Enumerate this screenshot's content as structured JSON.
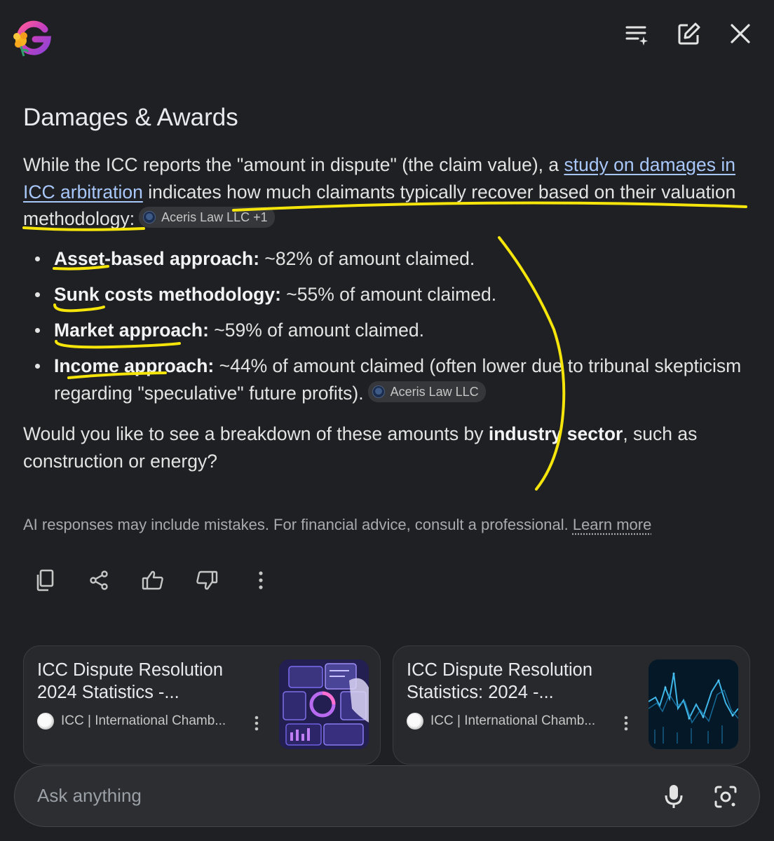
{
  "header": {
    "logo_icon": "google-g-flower-logo",
    "actions": [
      {
        "icon": "list-sparkle-icon"
      },
      {
        "icon": "edit-icon"
      },
      {
        "icon": "close-icon"
      }
    ]
  },
  "content": {
    "title": "Damages & Awards",
    "intro": {
      "before_link": "While the ICC reports the \"amount in dispute\" (the claim value), a ",
      "link_text": "study on damages in ICC arbitration",
      "after_link": " indicates how much claimants typically recover based on their valuation methodology:",
      "citation": "Aceris Law LLC +1"
    },
    "bullets": [
      {
        "label": "Asset-based approach:",
        "text": " ~82% of amount claimed."
      },
      {
        "label": "Sunk costs methodology:",
        "text": " ~55% of amount claimed."
      },
      {
        "label": "Market approach:",
        "text": " ~59% of amount claimed."
      },
      {
        "label": "Income approach:",
        "text": " ~44% of amount claimed (often lower due to tribunal skepticism regarding \"speculative\" future profits).",
        "citation": "Aceris Law LLC"
      }
    ],
    "followup": {
      "before": "Would you like to see a breakdown of these amounts by ",
      "bold": "industry sector",
      "after": ", such as construction or energy?"
    }
  },
  "disclaimer": {
    "text": "AI responses may include mistakes. For financial advice, consult a professional. ",
    "link": "Learn more"
  },
  "feedback_icons": [
    "copy-icon",
    "share-icon",
    "thumbs-up-icon",
    "thumbs-down-icon",
    "more-vertical-icon"
  ],
  "cards": [
    {
      "title": "ICC Dispute Resolution 2024 Statistics -...",
      "source": "ICC | International Chamb..."
    },
    {
      "title": "ICC Dispute Resolution Statistics: 2024 -...",
      "source": "ICC | International Chamb..."
    }
  ],
  "search": {
    "placeholder": "Ask anything"
  },
  "colors": {
    "background": "#1f2023",
    "link": "#a8c7fa",
    "annotation": "#f5e50a"
  }
}
